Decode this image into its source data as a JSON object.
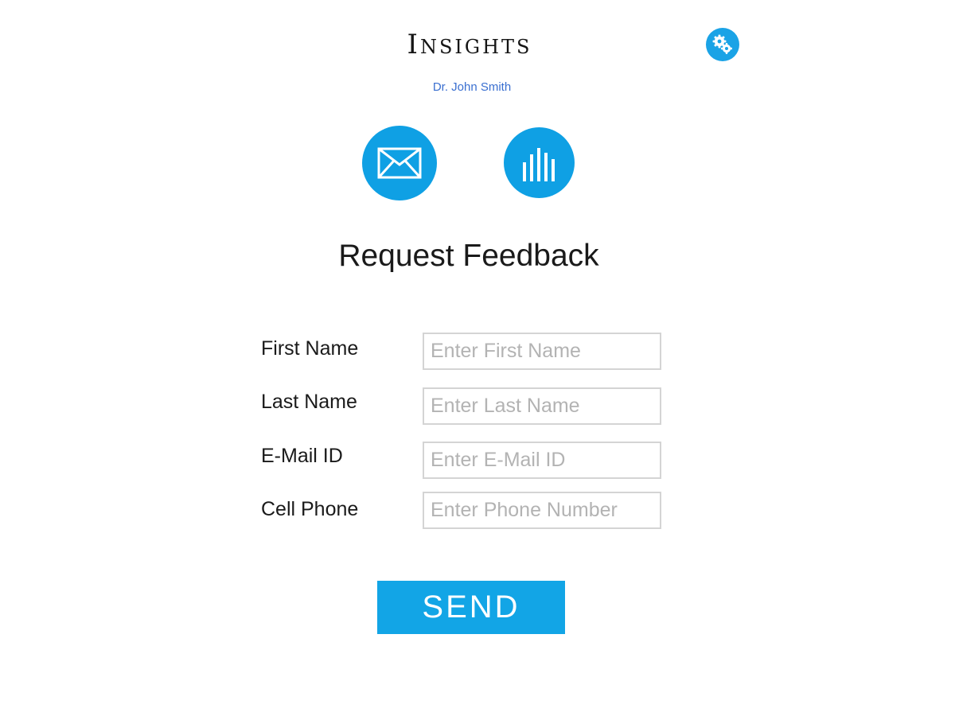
{
  "header": {
    "title": "Insights",
    "subtitle": "Dr. John Smith",
    "settings_icon": "gears-icon"
  },
  "actions": {
    "mail_icon": "envelope-icon",
    "stats_icon": "bar-chart-icon"
  },
  "form": {
    "heading": "Request Feedback",
    "fields": [
      {
        "label": "First Name",
        "placeholder": "Enter First Name",
        "value": ""
      },
      {
        "label": "Last Name",
        "placeholder": "Enter Last Name",
        "value": ""
      },
      {
        "label": "E-Mail ID",
        "placeholder": "Enter E-Mail ID",
        "value": ""
      },
      {
        "label": "Cell Phone",
        "placeholder": "Enter Phone Number",
        "value": ""
      }
    ],
    "submit_label": "SEND"
  },
  "colors": {
    "accent": "#12a5e6",
    "subtitle": "#3a6fd0",
    "input_border": "#d4d4d4",
    "placeholder": "#b3b3b3"
  }
}
